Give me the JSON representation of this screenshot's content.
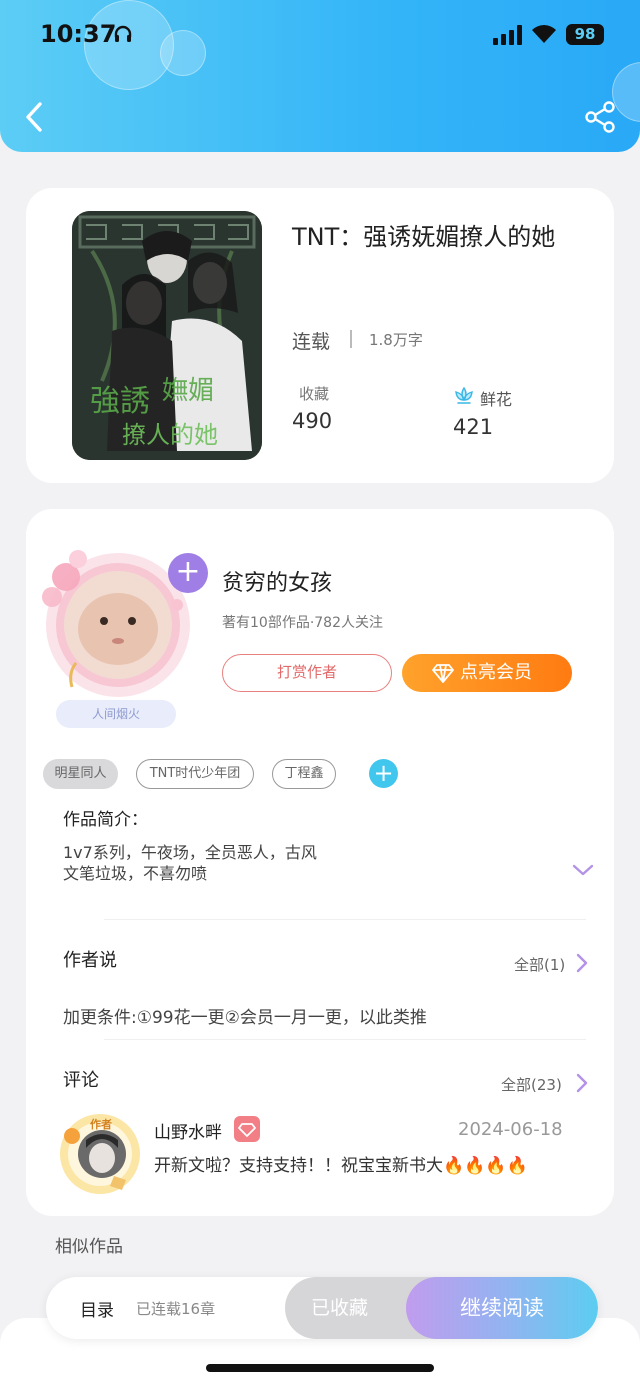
{
  "status_bar": {
    "time": "10:37",
    "battery": "98"
  },
  "book": {
    "title": "TNT：强诱妩媚撩人的她",
    "status": "连载",
    "word_count": "1.8万字",
    "favorites_label": "收藏",
    "favorites_count": "490",
    "flowers_label": "鲜花",
    "flowers_count": "421"
  },
  "author": {
    "name": "贫穷的女孩",
    "meta": "著有10部作品·782人关注",
    "frame_label": "人间烟火",
    "tip_button": "打赏作者",
    "vip_button": "点亮会员"
  },
  "tags": [
    "明星同人",
    "TNT时代少年团",
    "丁程鑫"
  ],
  "intro": {
    "title": "作品简介：",
    "lines": [
      "1v7系列，午夜场，全员恶人，古风",
      "文笔垃圾，不喜勿喷"
    ]
  },
  "author_says": {
    "title": "作者说",
    "all_label": "全部(1)",
    "text": "加更条件:①99花一更②会员一月一更，以此类推"
  },
  "comments": {
    "title": "评论",
    "all_label": "全部(23)",
    "items": [
      {
        "user": "山野水畔",
        "avatar_tag": "作者",
        "date": "2024-06-18",
        "text": "开新文啦？支持支持！！祝宝宝新书大🔥🔥🔥🔥"
      }
    ]
  },
  "similar_title": "相似作品",
  "bottom_bar": {
    "toc_label": "目录",
    "toc_sub": "已连载16章",
    "favorited_button": "已收藏",
    "read_button": "继续阅读"
  },
  "colors": {
    "header": "#34b5f8",
    "vip": "#ff8a1c",
    "accent_blue": "#41c6ee",
    "tip_red": "#e26a6a"
  }
}
